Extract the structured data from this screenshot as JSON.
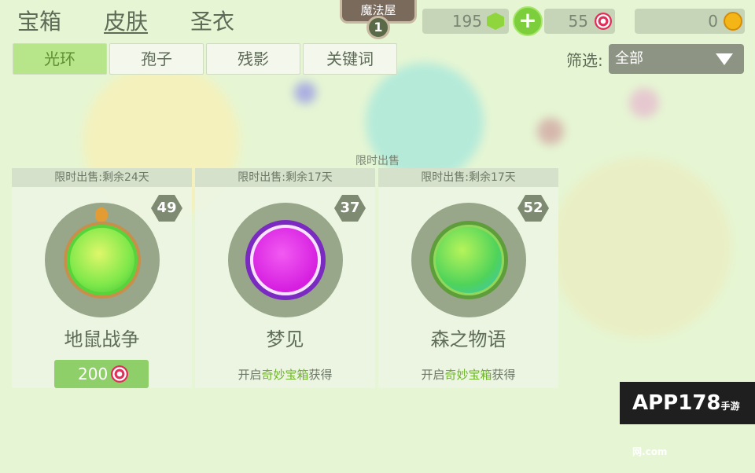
{
  "top_tabs": [
    {
      "label": "宝箱"
    },
    {
      "label": "皮肤"
    },
    {
      "label": "圣衣"
    }
  ],
  "house": {
    "title": "魔法屋",
    "level": "1"
  },
  "currency": {
    "gems": "195",
    "candies": "55",
    "coins": "0"
  },
  "sub_tabs": [
    {
      "label": "光环"
    },
    {
      "label": "孢子"
    },
    {
      "label": "残影"
    },
    {
      "label": "关键词"
    }
  ],
  "filter": {
    "label": "筛选:",
    "value": "全部"
  },
  "section_title": "限时出售",
  "cards": [
    {
      "header": "限时出售:剩余24天",
      "badge": "49",
      "name": "地鼠战争",
      "price": "200"
    },
    {
      "header": "限时出售:剩余17天",
      "badge": "37",
      "name": "梦见",
      "obtain_pre": "开启",
      "obtain_hl": "奇妙宝箱",
      "obtain_post": "获得"
    },
    {
      "header": "限时出售:剩余17天",
      "badge": "52",
      "name": "森之物语",
      "obtain_pre": "开启",
      "obtain_hl": "奇妙宝箱",
      "obtain_post": "获得"
    }
  ],
  "watermark": {
    "main": "APP178",
    "sub": "手游网",
    "suffix": ".com"
  }
}
